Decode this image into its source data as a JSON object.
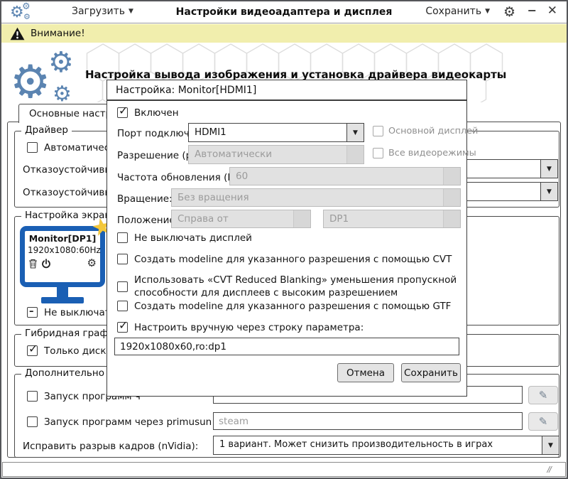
{
  "titlebar": {
    "load_label": "Загрузить",
    "title": "Настройки видеоадаптера и дисплея",
    "save_label": "Сохранить"
  },
  "warning": {
    "text": "Внимание!"
  },
  "header": {
    "title": "Настройка вывода изображения и установка драйвера видеокарты"
  },
  "tabs": {
    "main": "Основные настройки"
  },
  "driver_group": {
    "legend": "Драйвер",
    "auto_label": "Автоматический в",
    "failsafe1_label": "Отказоустойчивый др",
    "failsafe2_label": "Отказоустойчивый др"
  },
  "screen_group": {
    "legend": "Настройка экрана",
    "monitor_name": "Monitor[DP1]",
    "monitor_mode": "1920x1080:60Hz",
    "keep_on_label": "Не выключать ди"
  },
  "hybrid_group": {
    "legend": "Гибридная графика",
    "discrete_label": "Только дискретно"
  },
  "extra_group": {
    "legend": "Дополнительно",
    "run1_label": "Запуск программ ч",
    "run2_label": "Запуск программ через primusun (nVidia):",
    "run2_placeholder": "steam",
    "tearing_label": "Исправить разрыв кадров (nVidia):",
    "tearing_value": "1 вариант. Может снизить производительность в играх"
  },
  "dialog": {
    "title": "Настройка: Monitor[HDMI1]",
    "enabled_label": "Включен",
    "port_label": "Порт подключения:",
    "port_value": "HDMI1",
    "primary_label": "Основной дисплей",
    "resolution_label": "Разрешение (px):",
    "resolution_value": "Автоматически",
    "allmodes_label": "Все видеорежимы",
    "refresh_label": "Частота обновления (Hz):",
    "refresh_value": "60",
    "rotation_label": "Вращение:",
    "rotation_value": "Без вращения",
    "position_label": "Положение:",
    "position_value": "Справа от",
    "position_target": "DP1",
    "keep_display_label": "Не выключать дисплей",
    "cvt_label": "Создать modeline для указанного разрешения с помощью CVT",
    "cvt_rb_label": "Использовать «CVT Reduced Blanking» уменьшения пропускной способности для дисплеев с высоким разрешением",
    "gtf_label": "Создать modeline для указанного разрешения с помощью GTF",
    "manual_label": "Настроить вручную через строку параметра:",
    "manual_value": "1920x1080x60,ro:dp1",
    "cancel_label": "Отмена",
    "save_label": "Сохранить"
  },
  "icons": {
    "caret_down": "▼",
    "combo_arrow": "▼",
    "gear": "⚙",
    "minimize": "−",
    "close": "✕",
    "check": "✓",
    "dash": "–",
    "star": "★",
    "pencil": "✎",
    "resize": "∕∕"
  },
  "colors": {
    "accent_blue": "#5b84b1",
    "monitor_blue": "#1a5fb4",
    "warning_bg": "#f1eead",
    "star_gold": "#f3c73a"
  }
}
